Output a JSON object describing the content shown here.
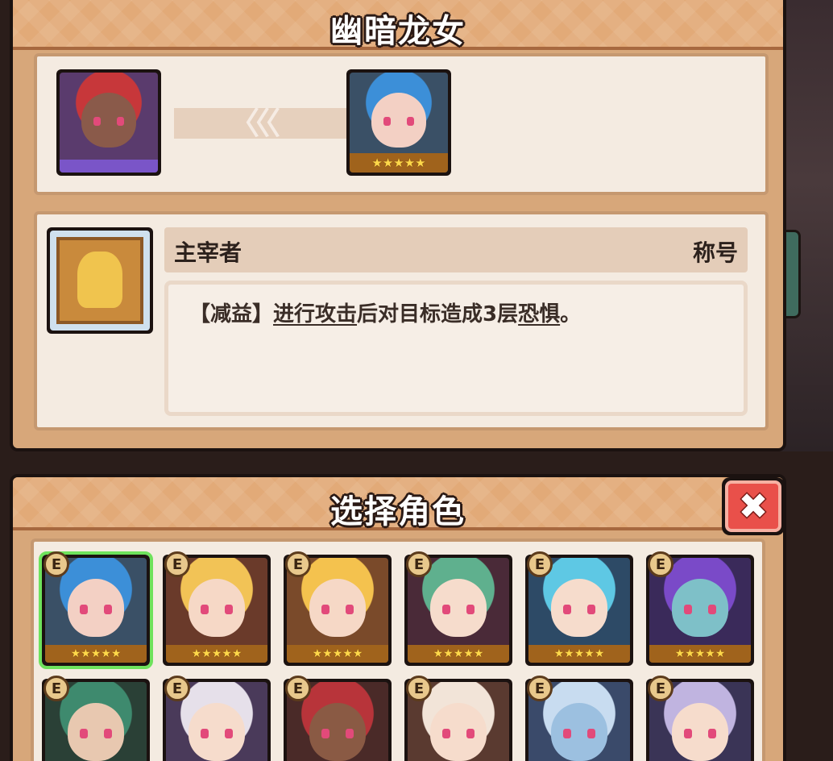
{
  "character": {
    "title": "幽暗龙女",
    "evolution": {
      "from": {
        "portrait_theme": "red-hair",
        "colors": {
          "bg": "#5a3b6d",
          "hair": "#c7373a",
          "skin": "#8a5a4a"
        }
      },
      "to": {
        "portrait_theme": "blue-hair",
        "stars": "★★★★★",
        "colors": {
          "bg": "#3a5066",
          "hair": "#3c8fd8",
          "skin": "#f3d0c4"
        }
      },
      "arrow_icon": "chevron-left-triple"
    },
    "skill": {
      "icon": "golden-figure-icon",
      "name": "主宰者",
      "type": "称号",
      "description": {
        "tag": "【减益】",
        "link1": "进行攻击",
        "mid": "后对目标造成3层",
        "link2": "恐惧",
        "end": "。"
      }
    }
  },
  "select": {
    "title": "选择角色",
    "close_label": "✖"
  },
  "roster": [
    {
      "badge": "E",
      "stars": "★★★★★",
      "selected": true,
      "colors": {
        "bg": "#3a5066",
        "hair": "#3c8fd8",
        "skin": "#f3d0c4"
      }
    },
    {
      "badge": "E",
      "stars": "★★★★★",
      "selected": false,
      "colors": {
        "bg": "#6a3a2a",
        "hair": "#f2c356",
        "skin": "#f6d8c6"
      }
    },
    {
      "badge": "E",
      "stars": "★★★★★",
      "selected": false,
      "colors": {
        "bg": "#7a4a2a",
        "hair": "#f4c24e",
        "skin": "#f6d8c6"
      }
    },
    {
      "badge": "E",
      "stars": "★★★★★",
      "selected": false,
      "colors": {
        "bg": "#4a2a38",
        "hair": "#5fb08e",
        "skin": "#f6dccc"
      }
    },
    {
      "badge": "E",
      "stars": "★★★★★",
      "selected": false,
      "colors": {
        "bg": "#2d4a66",
        "hair": "#5ec8e4",
        "skin": "#f6dccc"
      }
    },
    {
      "badge": "E",
      "stars": "★★★★★",
      "selected": false,
      "colors": {
        "bg": "#3a2a5a",
        "hair": "#7a4ac8",
        "skin": "#7ec0c8"
      }
    },
    {
      "badge": "E",
      "stars": "",
      "selected": false,
      "colors": {
        "bg": "#2a4036",
        "hair": "#3e8a6e",
        "skin": "#e8c8b0"
      }
    },
    {
      "badge": "E",
      "stars": "",
      "selected": false,
      "colors": {
        "bg": "#4a3a5a",
        "hair": "#e6e0ea",
        "skin": "#f6dccc"
      }
    },
    {
      "badge": "E",
      "stars": "",
      "selected": false,
      "colors": {
        "bg": "#4a2a28",
        "hair": "#b8343a",
        "skin": "#8a5a44"
      }
    },
    {
      "badge": "E",
      "stars": "",
      "selected": false,
      "colors": {
        "bg": "#5a3a30",
        "hair": "#f2e4d8",
        "skin": "#f6dccc"
      }
    },
    {
      "badge": "E",
      "stars": "",
      "selected": false,
      "colors": {
        "bg": "#3a4a6a",
        "hair": "#c8dcf0",
        "skin": "#9cc0e0"
      }
    },
    {
      "badge": "E",
      "stars": "",
      "selected": false,
      "colors": {
        "bg": "#3a3456",
        "hair": "#c0b4e0",
        "skin": "#f6dccc"
      }
    }
  ]
}
